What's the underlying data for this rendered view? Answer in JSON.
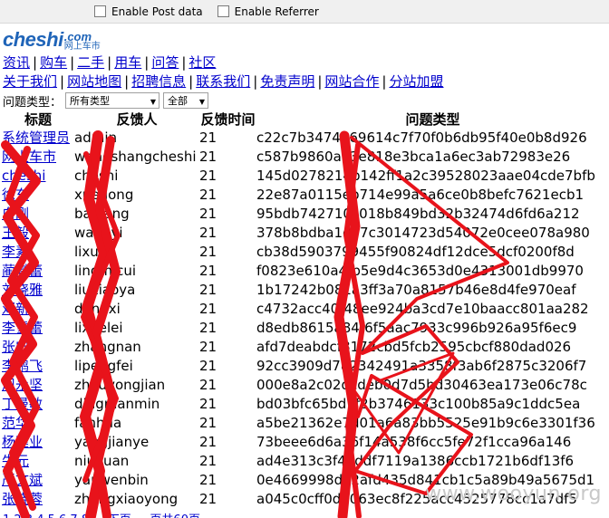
{
  "toolbar": {
    "post_label": "Enable Post data",
    "referrer_label": "Enable Referrer"
  },
  "logo": {
    "main": "cheshi",
    "com": ".com",
    "cn": "网上车市"
  },
  "nav_primary": [
    "资讯",
    "购车",
    "二手",
    "用车",
    "问答",
    "社区"
  ],
  "nav_secondary": [
    "关于我们",
    "网站地图",
    "招聘信息",
    "联系我们",
    "免责声明",
    "网站合作",
    "分站加盟"
  ],
  "filters": {
    "label": "问题类型：",
    "type_select": "所有类型",
    "status_select": "全部"
  },
  "table": {
    "headers": [
      "标题",
      "反馈人",
      "反馈时间",
      "问题类型"
    ],
    "rows": [
      [
        "系统管理员",
        "admin",
        "21",
        "c22c7b3474469614c7f70f0b6db95f40e0b8d926"
      ],
      [
        "网上车市",
        "wangshangcheshi",
        "21",
        "c587b9860ae3e818e3bca1a6ec3ab72983e26"
      ],
      [
        "cheshi",
        "cheshi",
        "21",
        "145d0278214b142ff1a2c39528023aae04cde7bfb"
      ],
      [
        "徐东",
        "xuedong",
        "21",
        "22e87a0115eb714e99a5a6ce0b8befc7621ecb1"
      ],
      [
        "白刚",
        "baigang",
        "21",
        "95bdb742710c018b849bd32b32474d6fd6a212"
      ],
      [
        "王毅",
        "wangyi",
        "21",
        "378b8bdba1d97c3014723d54072e0cee078a980"
      ],
      [
        "李素",
        "lixue",
        "21",
        "cb38d5903799455f90824df12dce5dcf0200f8d"
      ],
      [
        "蔺燮蕾",
        "lingmicui",
        "21",
        "f0823e610a4fb5e9d4c3653d0e4313001db9970"
      ],
      [
        "刘晓雅",
        "liuxiaoya",
        "21",
        "1b17242b081a3ff3a70a8157b46e8d4fe970eaf"
      ],
      [
        "邓新",
        "dengxi",
        "21",
        "c4732acc40f48ee924ba3cd7e10baacc801aa282"
      ],
      [
        "李雪蕾",
        "lixuelei",
        "21",
        "d8edb8615a84f6f5aac7933c996b926a95f6ec9"
      ],
      [
        "张宁",
        "zhangnan",
        "21",
        "afd7deabdcf8172cbd5fcb2595cbcf880dad026"
      ],
      [
        "李鹏飞",
        "lipengfei",
        "21",
        "92cc3909d782342491a3358f3ab6f2875c3206f7"
      ],
      [
        "周永坚",
        "zhouyongjian",
        "21",
        "000e8a2c02dcdeb0d7d5bd30463ea173e06c78c"
      ],
      [
        "丁曼敏",
        "dingmanmin",
        "21",
        "bd03bfc65bd7f2b3746133c100b85a9c1ddc5ea"
      ],
      [
        "范华",
        "fanhua",
        "21",
        "a5be21362e7d01a6a83bb5525e91b9c6e3301f36"
      ],
      [
        "杨建业",
        "yangjianye",
        "21",
        "73beee6d6a36f14a538f6cc5fe72f1cca96a146"
      ],
      [
        "牛元",
        "niuyuan",
        "21",
        "ad4e313c3f4bddf7119a1386ccb1721b6df13f6"
      ],
      [
        "严文斌",
        "yanwenbin",
        "21",
        "0e4669998de2afd435d841cb1c5a89b49a5675d1"
      ],
      [
        "张晓蓉",
        "zhangxiaoyong",
        "21",
        "a045c0cff0d2063ec8f225acc4525778cc1a7df5"
      ]
    ]
  },
  "pager": "1 2 3 4 5 6 7 8 ... 下页 ... 页共60页",
  "watermark": "www.wooyun.org",
  "colors": {
    "link": "#0000cc",
    "scribble": "#e8131b",
    "logo": "#1f64b8"
  }
}
